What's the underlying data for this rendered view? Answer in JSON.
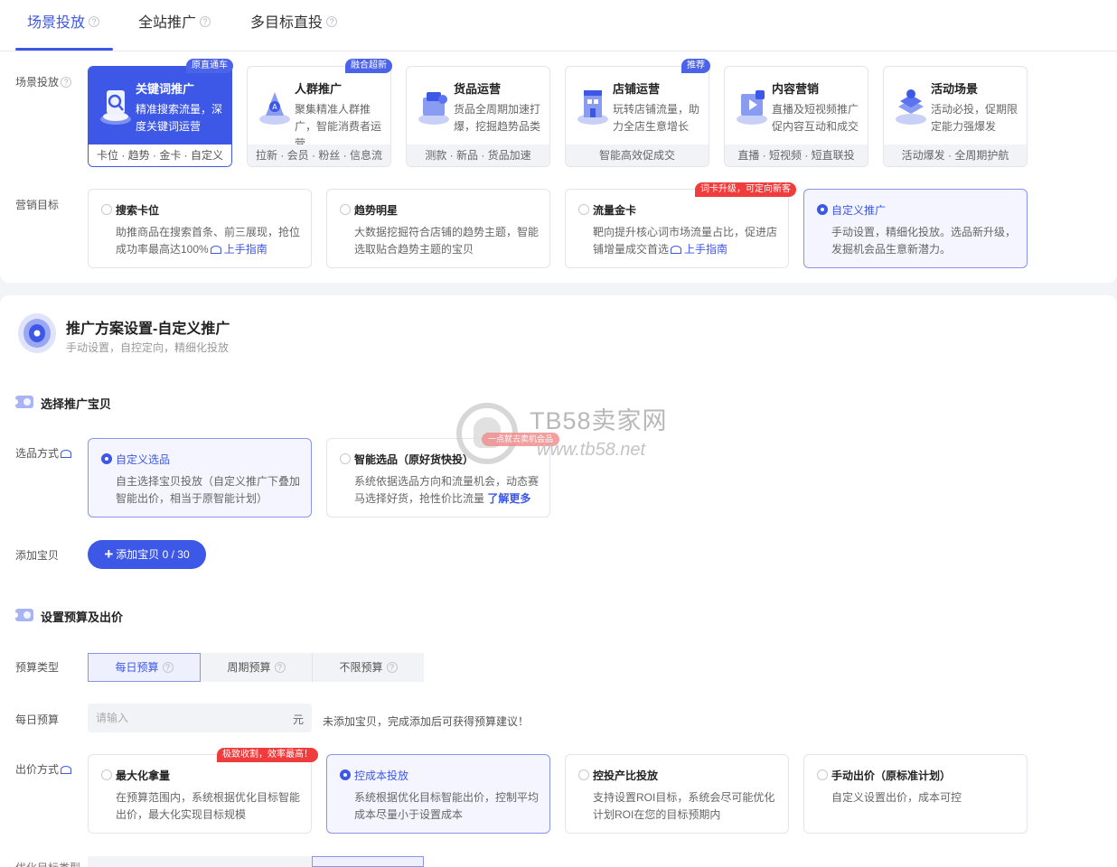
{
  "tabs": [
    {
      "label": "场景投放"
    },
    {
      "label": "全站推广"
    },
    {
      "label": "多目标直投"
    }
  ],
  "scene": {
    "label": "场景投放",
    "cards": [
      {
        "title": "关键词推广",
        "desc": "精准搜索流量，深度关键词运营",
        "foot": "卡位 · 趋势 · 金卡 · 自定义",
        "tag": "原直通车",
        "icon": "keyword-promo-icon"
      },
      {
        "title": "人群推广",
        "desc": "聚集精准人群推广，智能消费者运营",
        "foot": "拉新 · 会员 · 粉丝 · 信息流",
        "tag": "融合超新",
        "icon": "crowd-promo-icon"
      },
      {
        "title": "货品运营",
        "desc": "货品全周期加速打爆，挖掘趋势品类",
        "foot": "测款 · 新品 · 货品加速",
        "tag": "",
        "icon": "goods-ops-icon"
      },
      {
        "title": "店铺运营",
        "desc": "玩转店铺流量，助力全店生意增长",
        "foot": "智能高效促成交",
        "tag": "推荐",
        "icon": "store-ops-icon"
      },
      {
        "title": "内容营销",
        "desc": "直播及短视频推广促内容互动和成交",
        "foot": "直播 · 短视频 · 短直联投",
        "tag": "",
        "icon": "content-marketing-icon"
      },
      {
        "title": "活动场景",
        "desc": "活动必投，促期限定能力强爆发",
        "foot": "活动爆发 · 全周期护航",
        "tag": "",
        "icon": "activity-scene-icon"
      }
    ]
  },
  "goal": {
    "label": "营销目标",
    "options": [
      {
        "title": "搜索卡位",
        "desc": "助推商品在搜索首条、前三展现，抢位成功率最高达100%",
        "guide": "上手指南",
        "tag": ""
      },
      {
        "title": "趋势明星",
        "desc": "大数据挖掘符合店铺的趋势主题，智能选取贴合趋势主题的宝贝",
        "guide": "",
        "tag": ""
      },
      {
        "title": "流量金卡",
        "desc": "靶向提升核心词市场流量占比，促进店铺增量成交首选",
        "guide": "上手指南",
        "tag": "词卡升级，可定向新客"
      },
      {
        "title": "自定义推广",
        "desc": "手动设置，精细化投放。选品新升级，发掘机会品生意新潜力。",
        "guide": "",
        "tag": ""
      }
    ]
  },
  "plan": {
    "title": "推广方案设置-自定义推广",
    "subtitle": "手动设置，自控定向，精细化投放"
  },
  "section_select": {
    "title": "选择推广宝贝"
  },
  "select_method": {
    "label": "选品方式",
    "options": [
      {
        "title": "自定义选品",
        "desc": "自主选择宝贝投放（自定义推广下叠加智能出价，相当于原智能计划）"
      },
      {
        "title": "智能选品（原好货快投）",
        "desc": "系统依据选品方向和流量机会，动态赛马选择好货，抢性价比流量",
        "more": "了解更多"
      }
    ]
  },
  "add_item": {
    "label": "添加宝贝",
    "button": "添加宝贝 0 / 30"
  },
  "section_budget": {
    "title": "设置预算及出价"
  },
  "budget_type": {
    "label": "预算类型",
    "options": [
      "每日预算",
      "周期预算",
      "不限预算"
    ]
  },
  "daily_budget": {
    "label": "每日预算",
    "placeholder": "请输入",
    "unit": "元",
    "hint": "未添加宝贝，完成添加后可获得预算建议！"
  },
  "bid_method": {
    "label": "出价方式",
    "options": [
      {
        "title": "最大化拿量",
        "desc": "在预算范围内，系统根据优化目标智能出价，最大化实现目标规模",
        "tag": "极致收割，效率最高！"
      },
      {
        "title": "控成本投放",
        "desc": "系统根据优化目标智能出价，控制平均成本尽量小于设置成本",
        "tag": ""
      },
      {
        "title": "控投产比投放",
        "desc": "支持设置ROI目标，系统会尽可能优化计划ROI在您的目标预期内",
        "tag": ""
      },
      {
        "title": "手动出价（原标准计划）",
        "desc": "自定义设置出价，成本可控",
        "tag": ""
      }
    ]
  },
  "next_row": {
    "label": "优化目标类型"
  },
  "watermark": {
    "name": "TB58卖家网",
    "url": "www.tb58.net",
    "pill": "一点就去卖机会品"
  },
  "colors": {
    "accent": "#3d57e6",
    "tag_red": "#f03c3c",
    "card_border": "#e3e5ea"
  }
}
